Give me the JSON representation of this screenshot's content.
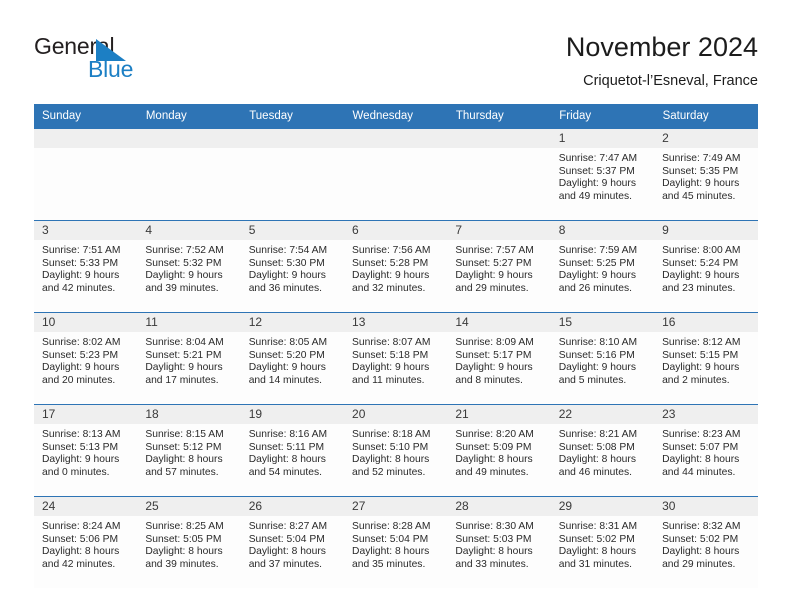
{
  "logo": {
    "text_primary": "General",
    "text_secondary": "Blue",
    "triangle_icon": "blue-triangle-icon",
    "accent_color": "#1c7fc4"
  },
  "header": {
    "title": "November 2024",
    "subtitle": "Criquetot-l’Esneval, France"
  },
  "theme": {
    "header_blue": "#2e74b5",
    "daynum_gray": "#efefef",
    "cell_bg": "#fdfdfd"
  },
  "calendar": {
    "weekday_headers": [
      "Sunday",
      "Monday",
      "Tuesday",
      "Wednesday",
      "Thursday",
      "Friday",
      "Saturday"
    ],
    "weeks": [
      [
        {
          "day": "",
          "sunrise": "",
          "sunset": "",
          "daylight_line1": "",
          "daylight_line2": ""
        },
        {
          "day": "",
          "sunrise": "",
          "sunset": "",
          "daylight_line1": "",
          "daylight_line2": ""
        },
        {
          "day": "",
          "sunrise": "",
          "sunset": "",
          "daylight_line1": "",
          "daylight_line2": ""
        },
        {
          "day": "",
          "sunrise": "",
          "sunset": "",
          "daylight_line1": "",
          "daylight_line2": ""
        },
        {
          "day": "",
          "sunrise": "",
          "sunset": "",
          "daylight_line1": "",
          "daylight_line2": ""
        },
        {
          "day": "1",
          "sunrise": "Sunrise: 7:47 AM",
          "sunset": "Sunset: 5:37 PM",
          "daylight_line1": "Daylight: 9 hours",
          "daylight_line2": "and 49 minutes."
        },
        {
          "day": "2",
          "sunrise": "Sunrise: 7:49 AM",
          "sunset": "Sunset: 5:35 PM",
          "daylight_line1": "Daylight: 9 hours",
          "daylight_line2": "and 45 minutes."
        }
      ],
      [
        {
          "day": "3",
          "sunrise": "Sunrise: 7:51 AM",
          "sunset": "Sunset: 5:33 PM",
          "daylight_line1": "Daylight: 9 hours",
          "daylight_line2": "and 42 minutes."
        },
        {
          "day": "4",
          "sunrise": "Sunrise: 7:52 AM",
          "sunset": "Sunset: 5:32 PM",
          "daylight_line1": "Daylight: 9 hours",
          "daylight_line2": "and 39 minutes."
        },
        {
          "day": "5",
          "sunrise": "Sunrise: 7:54 AM",
          "sunset": "Sunset: 5:30 PM",
          "daylight_line1": "Daylight: 9 hours",
          "daylight_line2": "and 36 minutes."
        },
        {
          "day": "6",
          "sunrise": "Sunrise: 7:56 AM",
          "sunset": "Sunset: 5:28 PM",
          "daylight_line1": "Daylight: 9 hours",
          "daylight_line2": "and 32 minutes."
        },
        {
          "day": "7",
          "sunrise": "Sunrise: 7:57 AM",
          "sunset": "Sunset: 5:27 PM",
          "daylight_line1": "Daylight: 9 hours",
          "daylight_line2": "and 29 minutes."
        },
        {
          "day": "8",
          "sunrise": "Sunrise: 7:59 AM",
          "sunset": "Sunset: 5:25 PM",
          "daylight_line1": "Daylight: 9 hours",
          "daylight_line2": "and 26 minutes."
        },
        {
          "day": "9",
          "sunrise": "Sunrise: 8:00 AM",
          "sunset": "Sunset: 5:24 PM",
          "daylight_line1": "Daylight: 9 hours",
          "daylight_line2": "and 23 minutes."
        }
      ],
      [
        {
          "day": "10",
          "sunrise": "Sunrise: 8:02 AM",
          "sunset": "Sunset: 5:23 PM",
          "daylight_line1": "Daylight: 9 hours",
          "daylight_line2": "and 20 minutes."
        },
        {
          "day": "11",
          "sunrise": "Sunrise: 8:04 AM",
          "sunset": "Sunset: 5:21 PM",
          "daylight_line1": "Daylight: 9 hours",
          "daylight_line2": "and 17 minutes."
        },
        {
          "day": "12",
          "sunrise": "Sunrise: 8:05 AM",
          "sunset": "Sunset: 5:20 PM",
          "daylight_line1": "Daylight: 9 hours",
          "daylight_line2": "and 14 minutes."
        },
        {
          "day": "13",
          "sunrise": "Sunrise: 8:07 AM",
          "sunset": "Sunset: 5:18 PM",
          "daylight_line1": "Daylight: 9 hours",
          "daylight_line2": "and 11 minutes."
        },
        {
          "day": "14",
          "sunrise": "Sunrise: 8:09 AM",
          "sunset": "Sunset: 5:17 PM",
          "daylight_line1": "Daylight: 9 hours",
          "daylight_line2": "and 8 minutes."
        },
        {
          "day": "15",
          "sunrise": "Sunrise: 8:10 AM",
          "sunset": "Sunset: 5:16 PM",
          "daylight_line1": "Daylight: 9 hours",
          "daylight_line2": "and 5 minutes."
        },
        {
          "day": "16",
          "sunrise": "Sunrise: 8:12 AM",
          "sunset": "Sunset: 5:15 PM",
          "daylight_line1": "Daylight: 9 hours",
          "daylight_line2": "and 2 minutes."
        }
      ],
      [
        {
          "day": "17",
          "sunrise": "Sunrise: 8:13 AM",
          "sunset": "Sunset: 5:13 PM",
          "daylight_line1": "Daylight: 9 hours",
          "daylight_line2": "and 0 minutes."
        },
        {
          "day": "18",
          "sunrise": "Sunrise: 8:15 AM",
          "sunset": "Sunset: 5:12 PM",
          "daylight_line1": "Daylight: 8 hours",
          "daylight_line2": "and 57 minutes."
        },
        {
          "day": "19",
          "sunrise": "Sunrise: 8:16 AM",
          "sunset": "Sunset: 5:11 PM",
          "daylight_line1": "Daylight: 8 hours",
          "daylight_line2": "and 54 minutes."
        },
        {
          "day": "20",
          "sunrise": "Sunrise: 8:18 AM",
          "sunset": "Sunset: 5:10 PM",
          "daylight_line1": "Daylight: 8 hours",
          "daylight_line2": "and 52 minutes."
        },
        {
          "day": "21",
          "sunrise": "Sunrise: 8:20 AM",
          "sunset": "Sunset: 5:09 PM",
          "daylight_line1": "Daylight: 8 hours",
          "daylight_line2": "and 49 minutes."
        },
        {
          "day": "22",
          "sunrise": "Sunrise: 8:21 AM",
          "sunset": "Sunset: 5:08 PM",
          "daylight_line1": "Daylight: 8 hours",
          "daylight_line2": "and 46 minutes."
        },
        {
          "day": "23",
          "sunrise": "Sunrise: 8:23 AM",
          "sunset": "Sunset: 5:07 PM",
          "daylight_line1": "Daylight: 8 hours",
          "daylight_line2": "and 44 minutes."
        }
      ],
      [
        {
          "day": "24",
          "sunrise": "Sunrise: 8:24 AM",
          "sunset": "Sunset: 5:06 PM",
          "daylight_line1": "Daylight: 8 hours",
          "daylight_line2": "and 42 minutes."
        },
        {
          "day": "25",
          "sunrise": "Sunrise: 8:25 AM",
          "sunset": "Sunset: 5:05 PM",
          "daylight_line1": "Daylight: 8 hours",
          "daylight_line2": "and 39 minutes."
        },
        {
          "day": "26",
          "sunrise": "Sunrise: 8:27 AM",
          "sunset": "Sunset: 5:04 PM",
          "daylight_line1": "Daylight: 8 hours",
          "daylight_line2": "and 37 minutes."
        },
        {
          "day": "27",
          "sunrise": "Sunrise: 8:28 AM",
          "sunset": "Sunset: 5:04 PM",
          "daylight_line1": "Daylight: 8 hours",
          "daylight_line2": "and 35 minutes."
        },
        {
          "day": "28",
          "sunrise": "Sunrise: 8:30 AM",
          "sunset": "Sunset: 5:03 PM",
          "daylight_line1": "Daylight: 8 hours",
          "daylight_line2": "and 33 minutes."
        },
        {
          "day": "29",
          "sunrise": "Sunrise: 8:31 AM",
          "sunset": "Sunset: 5:02 PM",
          "daylight_line1": "Daylight: 8 hours",
          "daylight_line2": "and 31 minutes."
        },
        {
          "day": "30",
          "sunrise": "Sunrise: 8:32 AM",
          "sunset": "Sunset: 5:02 PM",
          "daylight_line1": "Daylight: 8 hours",
          "daylight_line2": "and 29 minutes."
        }
      ]
    ]
  }
}
